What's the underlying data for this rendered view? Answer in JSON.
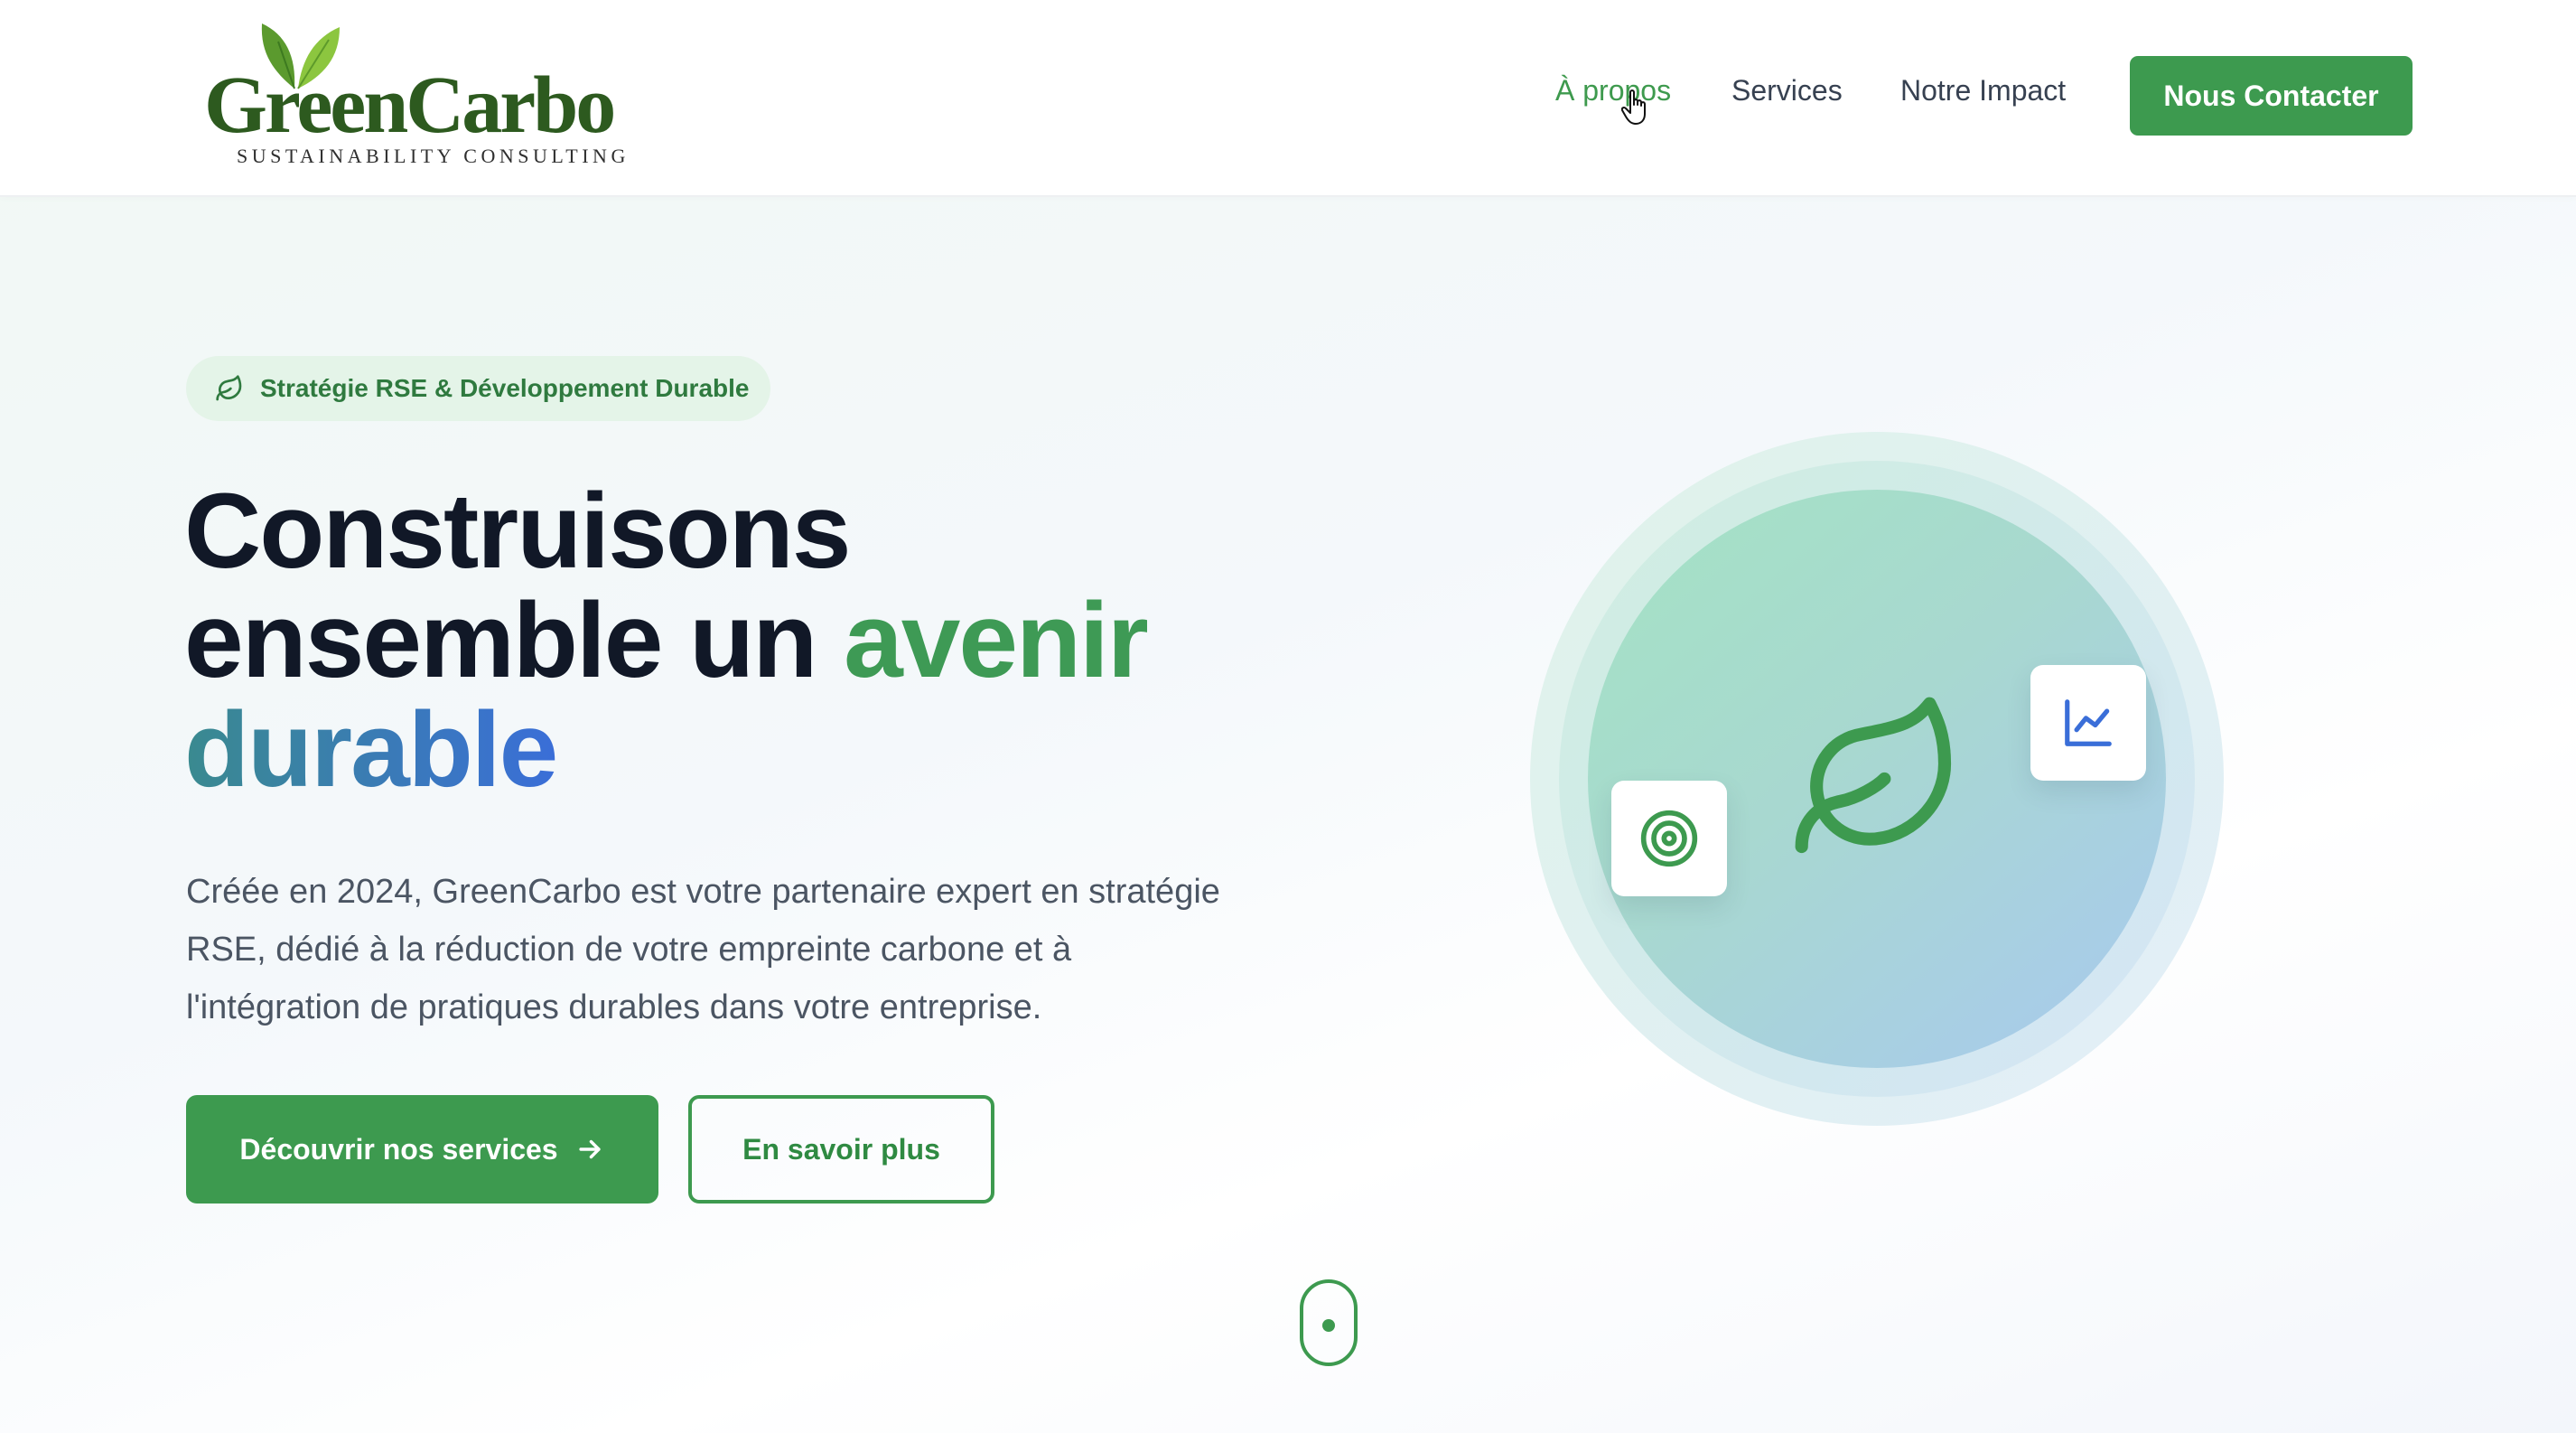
{
  "header": {
    "logo": {
      "name": "GreenCarbo",
      "tagline": "SUSTAINABILITY CONSULTING"
    },
    "nav": [
      {
        "label": "À propos",
        "active": true
      },
      {
        "label": "Services",
        "active": false
      },
      {
        "label": "Notre Impact",
        "active": false
      }
    ],
    "cta_label": "Nous Contacter"
  },
  "hero": {
    "badge": {
      "icon": "leaf-icon",
      "label": "Stratégie RSE & Développement Durable"
    },
    "headline": {
      "line1": "Construisons",
      "line2_a": "ensemble un ",
      "line2_b": "avenir",
      "line3": "durable"
    },
    "description": "Créée en 2024, GreenCarbo est votre partenaire expert en stratégie RSE, dédié à la réduction de votre empreinte carbone et à l'intégration de pratiques durables dans votre entreprise.",
    "primary_button": {
      "label": "Découvrir nos services",
      "icon": "arrow-right-icon"
    },
    "secondary_button": {
      "label": "En savoir plus"
    }
  },
  "illustration": {
    "center_icon": "leaf-icon",
    "cards": [
      "target-icon",
      "line-chart-icon"
    ]
  },
  "colors": {
    "brand_green": "#3d9a4f",
    "text_dark": "#111827",
    "gradient_blue": "#3a6ed8"
  }
}
